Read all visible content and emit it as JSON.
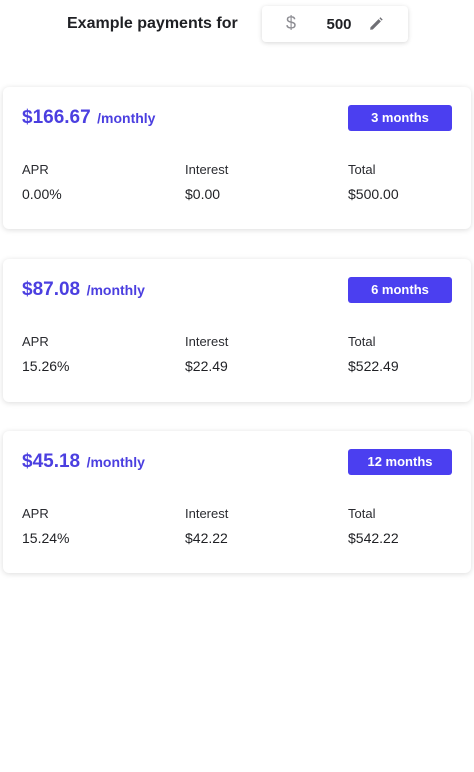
{
  "header": {
    "title": "Example payments for",
    "currency_symbol": "$",
    "amount": "500",
    "edit_icon": "pencil-icon"
  },
  "plans": [
    {
      "monthly_amount": "$166.67",
      "monthly_suffix": "/monthly",
      "term": "3 months",
      "apr_label": "APR",
      "apr": "0.00%",
      "interest_label": "Interest",
      "interest": "$0.00",
      "total_label": "Total",
      "total": "$500.00"
    },
    {
      "monthly_amount": "$87.08",
      "monthly_suffix": "/monthly",
      "term": "6 months",
      "apr_label": "APR",
      "apr": "15.26%",
      "interest_label": "Interest",
      "interest": "$22.49",
      "total_label": "Total",
      "total": "$522.49"
    },
    {
      "monthly_amount": "$45.18",
      "monthly_suffix": "/monthly",
      "term": "12 months",
      "apr_label": "APR",
      "apr": "15.24%",
      "interest_label": "Interest",
      "interest": "$42.22",
      "total_label": "Total",
      "total": "$542.22"
    }
  ],
  "colors": {
    "accent": "#4b3fe0",
    "badge": "#4b3ff0",
    "text": "#1f2024"
  }
}
